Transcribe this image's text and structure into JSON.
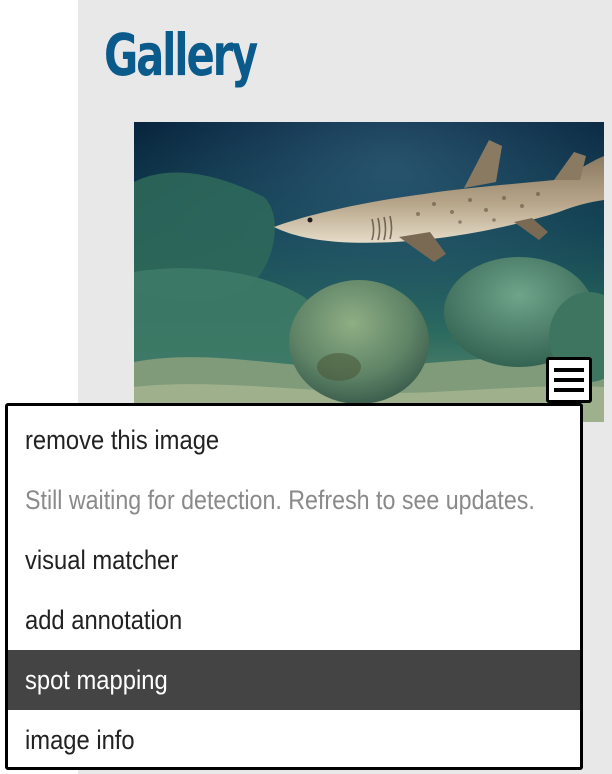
{
  "page": {
    "title": "Gallery"
  },
  "gallery": {
    "image_alt": "shark swimming over rocks",
    "menu_button_icon": "hamburger-icon"
  },
  "menu": {
    "items": [
      {
        "label": "remove this image",
        "state": "normal"
      },
      {
        "label": "Still waiting for detection. Refresh to see updates.",
        "state": "disabled"
      },
      {
        "label": "visual matcher",
        "state": "normal"
      },
      {
        "label": "add annotation",
        "state": "normal"
      },
      {
        "label": "spot mapping",
        "state": "highlighted"
      },
      {
        "label": "image info",
        "state": "normal"
      }
    ]
  },
  "colors": {
    "title": "#0b5a8c",
    "panel_bg": "#e8e8e8",
    "highlight_bg": "#444444",
    "disabled_text": "#8a8a8a"
  }
}
